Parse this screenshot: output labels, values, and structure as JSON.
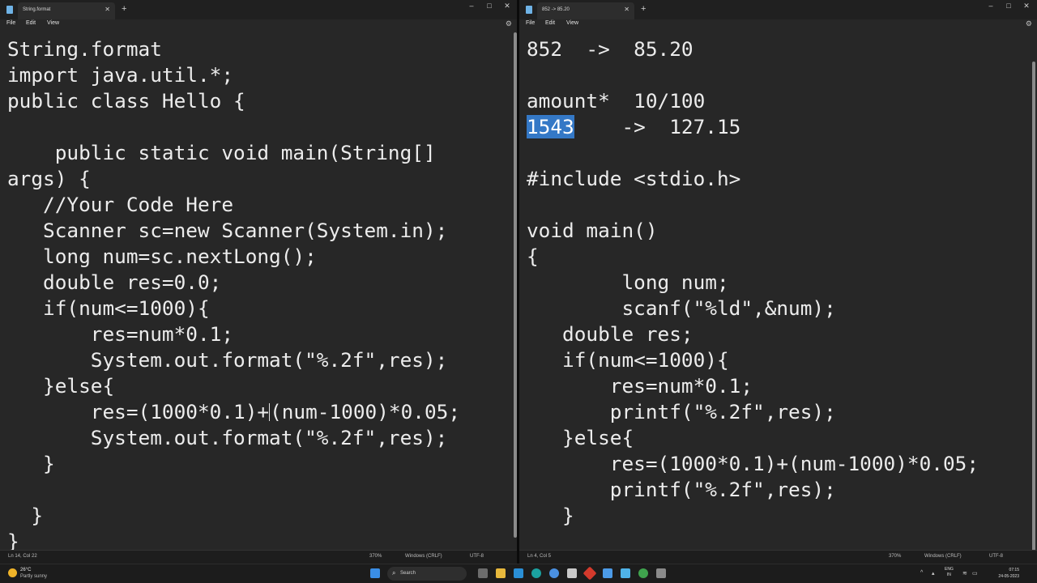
{
  "left_window": {
    "tab_title": "String.format",
    "menu": [
      "File",
      "Edit",
      "View"
    ],
    "code": {
      "line1": "String.format",
      "line2": "import java.util.*;",
      "line3": "public class Hello {",
      "line4": "",
      "line5": "    public static void main(String[]",
      "line6": "args) {",
      "line7": "   //Your Code Here",
      "line8": "   Scanner sc=new Scanner(System.in);",
      "line9": "   long num=sc.nextLong();",
      "line10": "   double res=0.0;",
      "line11": "   if(num<=1000){",
      "line12": "       res=num*0.1;",
      "line13": "       System.out.format(\"%.2f\",res);",
      "line14": "   }else{",
      "line15a": "       res=(1000*0.1)+",
      "line15b": "(num-1000)*0.05;",
      "line16": "       System.out.format(\"%.2f\",res);",
      "line17": "   }",
      "line18": "",
      "line19": "  }",
      "line20": "}"
    },
    "status": {
      "position": "Ln 14, Col 22",
      "zoom": "370%",
      "line_ending": "Windows (CRLF)",
      "encoding": "UTF-8"
    }
  },
  "right_window": {
    "tab_title": "852 -> 85.20",
    "menu": [
      "File",
      "Edit",
      "View"
    ],
    "code": {
      "line1": "852  ->  85.20",
      "line2": "",
      "line3": "amount*  10/100",
      "line4_sel": "1543",
      "line4_rest": "    ->  127.15",
      "line5": "",
      "line6": "#include <stdio.h>",
      "line7": "",
      "line8": "void main()",
      "line9": "{",
      "line10": "        long num;",
      "line11": "        scanf(\"%ld\",&num);",
      "line12": "   double res;",
      "line13": "   if(num<=1000){",
      "line14": "       res=num*0.1;",
      "line15": "       printf(\"%.2f\",res);",
      "line16": "   }else{",
      "line17": "       res=(1000*0.1)+(num-1000)*0.05;",
      "line18": "       printf(\"%.2f\",res);",
      "line19": "   }"
    },
    "status": {
      "position": "Ln 4, Col 5",
      "zoom": "370%",
      "line_ending": "Windows (CRLF)",
      "encoding": "UTF-8"
    }
  },
  "window_controls": {
    "minimize": "–",
    "maximize": "□",
    "close": "✕"
  },
  "taskbar": {
    "weather_temp": "26°C",
    "weather_condition": "Partly sunny",
    "search_placeholder": "Search",
    "language_line1": "ENG",
    "language_line2": "IN",
    "time": "07:15",
    "date": "24-05-2023",
    "icons": [
      "windows-start-icon",
      "search-icon",
      "task-view-icon",
      "file-explorer-icon",
      "edge-icon",
      "settings-icon",
      "store-icon",
      "app-icon",
      "notepad-icon",
      "chrome-icon",
      "app-icon",
      "calculator-icon"
    ]
  },
  "colors": {
    "editor_bg": "#272727",
    "selection": "#3478c6",
    "text": "#ececec"
  }
}
